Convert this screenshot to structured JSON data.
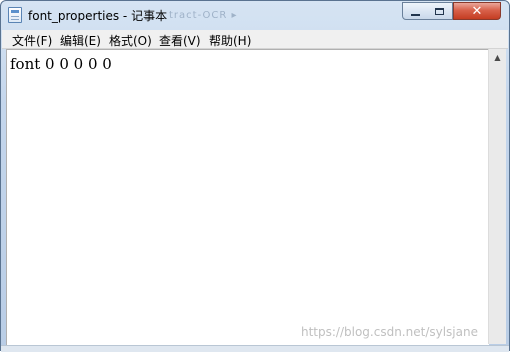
{
  "window": {
    "title": "font_properties - 记事本",
    "background_text": "tract-OCR ▸"
  },
  "controls": {
    "close_symbol": "✕"
  },
  "menu": {
    "items": [
      {
        "label": "文件(F)"
      },
      {
        "label": "编辑(E)"
      },
      {
        "label": "格式(O)"
      },
      {
        "label": "查看(V)"
      },
      {
        "label": "帮助(H)"
      }
    ]
  },
  "editor": {
    "content": "font 0 0 0 0 0"
  },
  "scrollbar": {
    "up_arrow": "▲"
  },
  "watermark": {
    "text": "https://blog.csdn.net/sylsjane"
  }
}
